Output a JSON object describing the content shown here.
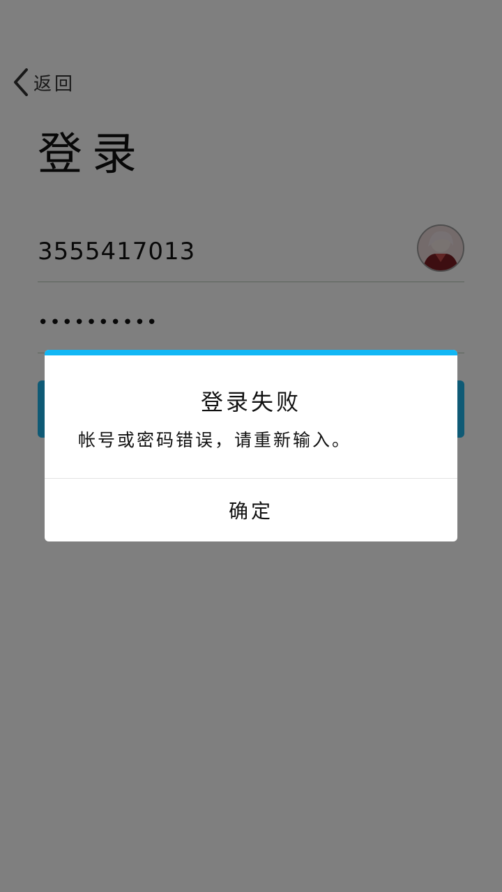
{
  "header": {
    "back_label": "返回",
    "title": "登录"
  },
  "form": {
    "account_value": "3555417013",
    "password_value": "••••••••••"
  },
  "dialog": {
    "title": "登录失败",
    "message": "帐号或密码错误，请重新输入。",
    "confirm_label": "确定"
  },
  "colors": {
    "accent": "#12b7f5",
    "overlay": "rgba(0,0,0,0.5)"
  }
}
